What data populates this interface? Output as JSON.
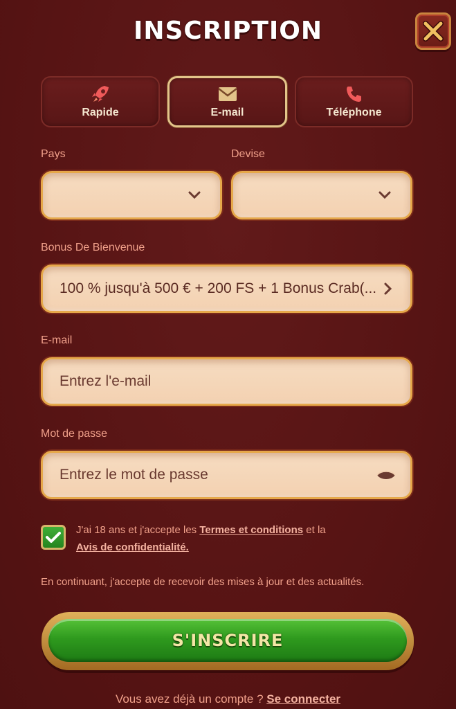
{
  "header": {
    "title": "INSCRIPTION"
  },
  "tabs": [
    {
      "label": "Rapide",
      "icon": "rocket-icon",
      "active": false
    },
    {
      "label": "E-mail",
      "icon": "envelope-icon",
      "active": true
    },
    {
      "label": "Téléphone",
      "icon": "phone-icon",
      "active": false
    }
  ],
  "form": {
    "country": {
      "label": "Pays",
      "value": ""
    },
    "currency": {
      "label": "Devise",
      "value": ""
    },
    "bonus": {
      "label": "Bonus De Bienvenue",
      "value": "100 % jusqu'à 500 € + 200 FS + 1 Bonus Crab(..."
    },
    "email": {
      "label": "E-mail",
      "placeholder": "Entrez l'e-mail"
    },
    "password": {
      "label": "Mot de passe",
      "placeholder": "Entrez le mot de passe"
    }
  },
  "consent": {
    "checked": true,
    "text_before": "J'ai 18 ans et j'accepte les ",
    "terms_link": "Termes et conditions",
    "text_middle": " et la ",
    "privacy_link": "Avis de confidentialité."
  },
  "info": "En continuant, j'accepte de recevoir des mises à jour et des actualités.",
  "submit": {
    "label": "S'INSCRIRE"
  },
  "login": {
    "prompt": "Vous avez déjà un compte ? ",
    "link": "Se connecter"
  },
  "colors": {
    "background": "#5a1515",
    "accent_gold": "#e6a84a",
    "label_pink": "#f0a08a",
    "button_green": "#2f9a1e"
  }
}
